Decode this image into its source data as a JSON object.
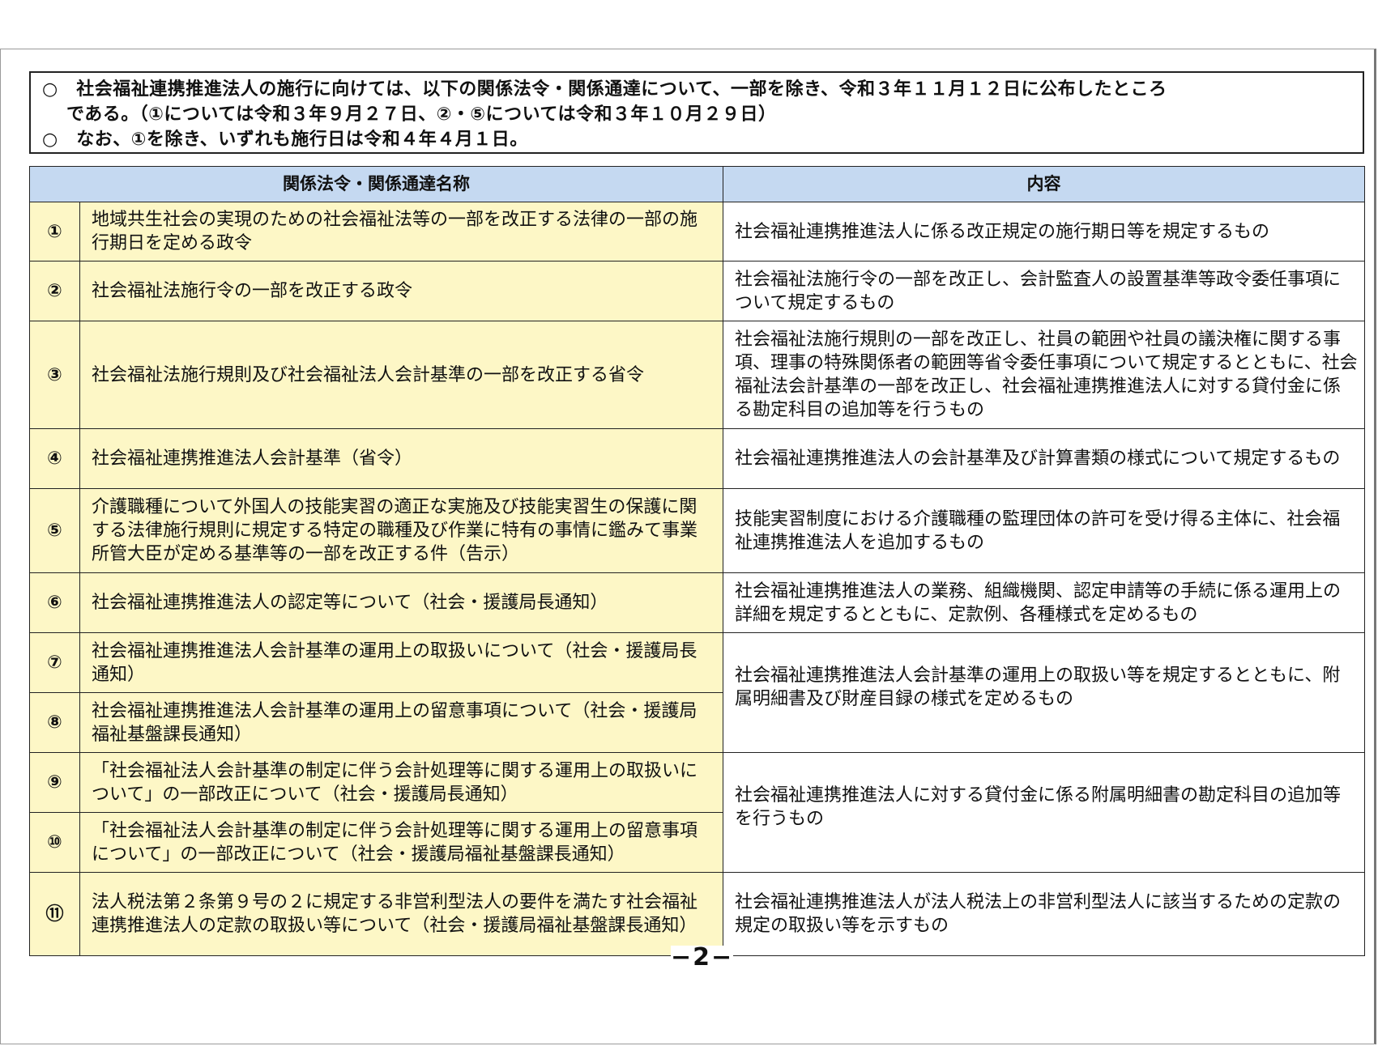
{
  "notice": {
    "line1": "○　社会福祉連携推進法人の施行に向けては、以下の関係法令・関係通達について、一部を除き、令和３年１１月１２日に公布したところ",
    "line2": "である。（①については令和３年９月２７日、②・⑤については令和３年１０月２９日）",
    "line3": "○　なお、①を除き、いずれも施行日は令和４年４月１日。"
  },
  "table": {
    "header_name": "関係法令・関係通達名称",
    "header_content": "内容",
    "rows": [
      {
        "num": "①",
        "name": "地域共生社会の実現のための社会福祉法等の一部を改正する法律の一部の施行期日を定める政令",
        "content": "社会福祉連携推進法人に係る改正規定の施行期日等を規定するもの"
      },
      {
        "num": "②",
        "name": "社会福祉法施行令の一部を改正する政令",
        "content": "社会福祉法施行令の一部を改正し、会計監査人の設置基準等政令委任事項について規定するもの"
      },
      {
        "num": "③",
        "name": "社会福祉法施行規則及び社会福祉法人会計基準の一部を改正する省令",
        "content": "社会福祉法施行規則の一部を改正し、社員の範囲や社員の議決権に関する事項、理事の特殊関係者の範囲等省令委任事項について規定するとともに、社会福祉法会計基準の一部を改正し、社会福祉連携推進法人に対する貸付金に係る勘定科目の追加等を行うもの"
      },
      {
        "num": "④",
        "name": "社会福祉連携推進法人会計基準（省令）",
        "content": "社会福祉連携推進法人の会計基準及び計算書類の様式について規定するもの"
      },
      {
        "num": "⑤",
        "name": "介護職種について外国人の技能実習の適正な実施及び技能実習生の保護に関する法律施行規則に規定する特定の職種及び作業に特有の事情に鑑みて事業所管大臣が定める基準等の一部を改正する件（告示）",
        "content": "技能実習制度における介護職種の監理団体の許可を受け得る主体に、社会福祉連携推進法人を追加するもの"
      },
      {
        "num": "⑥",
        "name": "社会福祉連携推進法人の認定等について（社会・援護局長通知）",
        "content": "社会福祉連携推進法人の業務、組織機関、認定申請等の手続に係る運用上の詳細を規定するとともに、定款例、各種様式を定めるもの"
      },
      {
        "num": "⑦",
        "name": "社会福祉連携推進法人会計基準の運用上の取扱いについて（社会・援護局長通知）",
        "content": "社会福祉連携推進法人会計基準の運用上の取扱い等を規定するとともに、附属明細書及び財産目録の様式を定めるもの"
      },
      {
        "num": "⑧",
        "name": "社会福祉連携推進法人会計基準の運用上の留意事項について（社会・援護局福祉基盤課長通知）",
        "content": ""
      },
      {
        "num": "⑨",
        "name": "「社会福祉法人会計基準の制定に伴う会計処理等に関する運用上の取扱いについて」の一部改正について（社会・援護局長通知）",
        "content": "社会福祉連携推進法人に対する貸付金に係る附属明細書の勘定科目の追加等を行うもの"
      },
      {
        "num": "⑩",
        "name": "「社会福祉法人会計基準の制定に伴う会計処理等に関する運用上の留意事項について」の一部改正について（社会・援護局福祉基盤課長通知）",
        "content": ""
      },
      {
        "num": "⑪",
        "name": "法人税法第２条第９号の２に規定する非営利型法人の要件を満たす社会福祉連携推進法人の定款の取扱い等について（社会・援護局福祉基盤課長通知）",
        "content": "社会福祉連携推進法人が法人税法上の非営利型法人に該当するための定款の規定の取扱い等を示すもの"
      }
    ]
  },
  "page_number": "−2−"
}
